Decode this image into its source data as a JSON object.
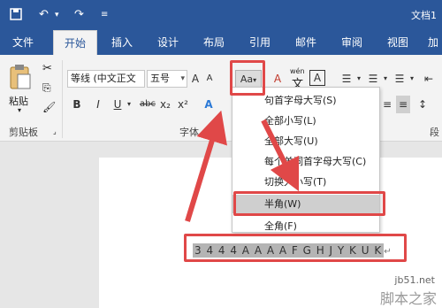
{
  "titlebar": {
    "doc_title": "文档1"
  },
  "tabs": [
    {
      "label": "文件"
    },
    {
      "label": "开始"
    },
    {
      "label": "插入"
    },
    {
      "label": "设计"
    },
    {
      "label": "布局"
    },
    {
      "label": "引用"
    },
    {
      "label": "邮件"
    },
    {
      "label": "审阅"
    },
    {
      "label": "视图"
    },
    {
      "label": "加"
    }
  ],
  "clipboard": {
    "paste_label": "粘贴",
    "group_label": "剪贴板"
  },
  "font": {
    "name": "等线 (中文正文",
    "size": "五号",
    "case_button": "Aa",
    "group_label": "字体",
    "wen_label": "wén",
    "wen_char": "文",
    "boxed_char": "A"
  },
  "format_buttons": [
    "B",
    "I",
    "U",
    "abc",
    "x₂",
    "x²"
  ],
  "paragraph": {
    "group_label": "段"
  },
  "change_case_menu": [
    {
      "label": "句首字母大写(S)"
    },
    {
      "label": "全部小写(L)"
    },
    {
      "label": "全部大写(U)"
    },
    {
      "label": "每个单词首字母大写(C)"
    },
    {
      "label": "切换大小写(T)"
    },
    {
      "label": "半角(W)"
    },
    {
      "label": "全角(F)"
    }
  ],
  "document": {
    "text": "3 4 4 4 A A A A F G H J Y K U K"
  },
  "watermark": {
    "line1": "jb51.net",
    "line2": "脚本之家"
  },
  "colors": {
    "brand": "#2b579a",
    "annotation": "#e04848"
  }
}
